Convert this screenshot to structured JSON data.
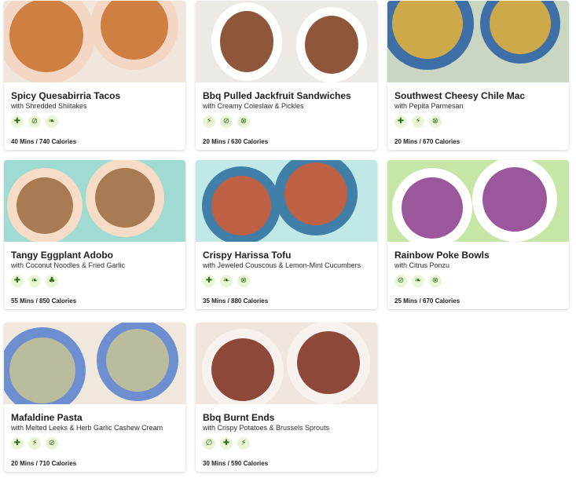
{
  "recipes": [
    {
      "title": "Spicy Quesabirria Tacos",
      "subtitle": "with Shredded Shiitakes",
      "meta": "40 Mins / 740 Calories",
      "icons": [
        "tag-icon",
        "no-gluten-icon",
        "leaf-icon"
      ],
      "bg": "#f0e6dc",
      "plate": "#f3d6c4",
      "food": "#c8702a"
    },
    {
      "title": "Bbq Pulled Jackfruit Sandwiches",
      "subtitle": "with Creamy Coleslaw & Pickles",
      "meta": "20 Mins / 630 Calories",
      "icons": [
        "bolt-icon",
        "no-gluten-icon",
        "no-nuts-icon"
      ],
      "bg": "#ede9e5",
      "plate": "#ffffff",
      "food": "#7a3a1a"
    },
    {
      "title": "Southwest Cheesy Chile Mac",
      "subtitle": "with Pepita Parmesan",
      "meta": "20 Mins / 670 Calories",
      "icons": [
        "tag-icon",
        "bolt-icon",
        "no-nuts-icon"
      ],
      "bg": "#c9d6c2",
      "plate": "#3e6fa6",
      "food": "#e6b43a"
    },
    {
      "title": "Tangy Eggplant Adobo",
      "subtitle": "with Coconut Noodles & Fried Garlic",
      "meta": "55 Mins / 850 Calories",
      "icons": [
        "tag-icon",
        "leaf-icon",
        "sprout-icon"
      ],
      "bg": "#9fdbd3",
      "plate": "#f6dcc6",
      "food": "#9a6a3e"
    },
    {
      "title": "Crispy Harissa Tofu",
      "subtitle": "with Jeweled Couscous & Lemon-Mint Cucumbers",
      "meta": "35 Mins / 880 Calories",
      "icons": [
        "tag-icon",
        "leaf-icon",
        "no-nuts-icon"
      ],
      "bg": "#bfe8e6",
      "plate": "#3f7fa8",
      "food": "#d35a32"
    },
    {
      "title": "Rainbow Poke Bowls",
      "subtitle": "with Citrus Ponzu",
      "meta": "25 Mins / 670 Calories",
      "icons": [
        "no-gluten-icon",
        "leaf-icon",
        "no-nuts-icon"
      ],
      "bg": "#c6e6a6",
      "plate": "#ffffff",
      "food": "#8a3a8a"
    },
    {
      "title": "Mafaldine Pasta",
      "subtitle": "with Melted Leeks & Herb Garlic Cashew Cream",
      "meta": "20 Mins / 710 Calories",
      "icons": [
        "tag-icon",
        "bolt-icon",
        "no-gluten-icon"
      ],
      "bg": "#f1e8dd",
      "plate": "#6d8fd0",
      "food": "#c9c394"
    },
    {
      "title": "Bbq Burnt Ends",
      "subtitle": "with Crispy Potatoes & Brussels Sprouts",
      "meta": "30 Mins / 590 Calories",
      "icons": [
        "no-peanut-icon",
        "tag-icon",
        "bolt-icon"
      ],
      "bg": "#efe7de",
      "plate": "#f7f2ee",
      "food": "#7a2a1a"
    }
  ],
  "icon_glyphs": {
    "tag-icon": "✚",
    "no-gluten-icon": "⊘",
    "leaf-icon": "❧",
    "bolt-icon": "⚡",
    "no-nuts-icon": "⊗",
    "sprout-icon": "♣",
    "no-peanut-icon": "∅"
  }
}
